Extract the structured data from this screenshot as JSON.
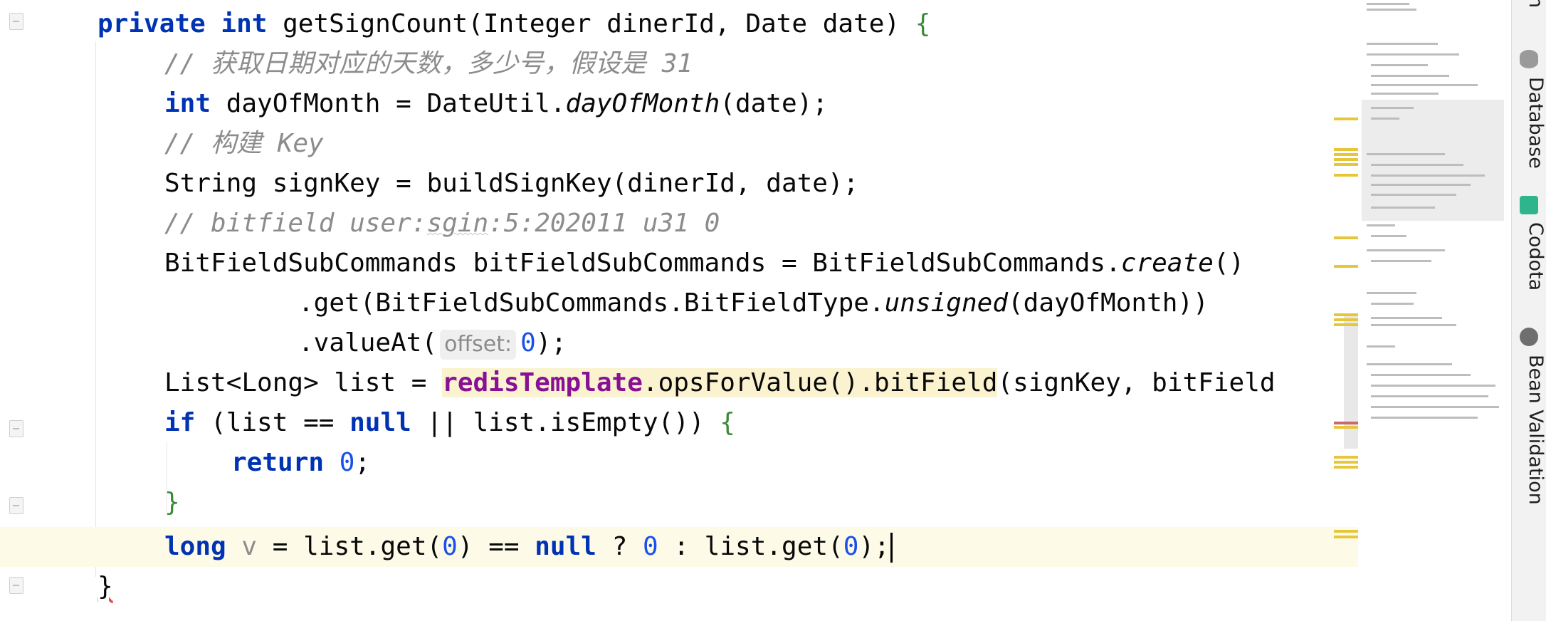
{
  "editor": {
    "lines": {
      "l1": {
        "kw1": "private",
        "kw2": "int",
        "rest": " getSignCount(Integer dinerId, Date date) ",
        "brace": "{"
      },
      "l2": {
        "comment": "// 获取日期对应的天数，多少号，假设是 31"
      },
      "l3": {
        "kw": "int",
        "a": " dayOfMonth = DateUtil.",
        "m": "dayOfMonth",
        "b": "(date);"
      },
      "l4": {
        "comment": "// 构建 Key"
      },
      "l5": {
        "text": "String signKey = buildSignKey(dinerId, date);"
      },
      "l6": {
        "c1": "// bitfield user:",
        "c2": "sgin",
        "c3": ":5:202011 u31 0"
      },
      "l7": {
        "a": "BitFieldSubCommands bitFieldSubCommands = BitFieldSubCommands.",
        "m": "create",
        "b": "()"
      },
      "l8": {
        "a": ".get(BitFieldSubCommands.BitFieldType.",
        "m": "unsigned",
        "b": "(dayOfMonth))"
      },
      "l9": {
        "a": ".valueAt(",
        "hint": "offset:",
        "num": "0",
        "b": ");"
      },
      "l10": {
        "a": "List<Long> list = ",
        "field": "redisTemplate",
        "hl": ".opsForValue().bitField",
        "b": "(signKey, bitField"
      },
      "l11": {
        "kw": "if",
        "a": " (list == ",
        "kw2": "null",
        "b": " || list.isEmpty()) ",
        "brace": "{"
      },
      "l12": {
        "kw": "return",
        "num": "0",
        "b": ";"
      },
      "l13": {
        "brace": "}"
      },
      "l14": {
        "kw": "long",
        "v": "v",
        "a": " = list.get(",
        "n1": "0",
        "b": ") == ",
        "kw2": "null",
        "c": " ? ",
        "n2": "0",
        "d": " : list.get(",
        "n3": "0",
        "e": ");"
      },
      "l15": {
        "brace": "}"
      }
    }
  },
  "toolstrip": {
    "partial_top": "n",
    "tabs": [
      {
        "label": "Database",
        "icon": "database-icon"
      },
      {
        "label": "Codota",
        "icon": "codota-icon"
      },
      {
        "label": "Bean Validation",
        "icon": "bean-validation-icon"
      }
    ]
  },
  "colors": {
    "keyword": "#0033b3",
    "comment": "#8c8c8c",
    "number": "#1750eb",
    "field": "#871094",
    "current_line": "#fdfbe8",
    "marker": "#e6c63a"
  }
}
